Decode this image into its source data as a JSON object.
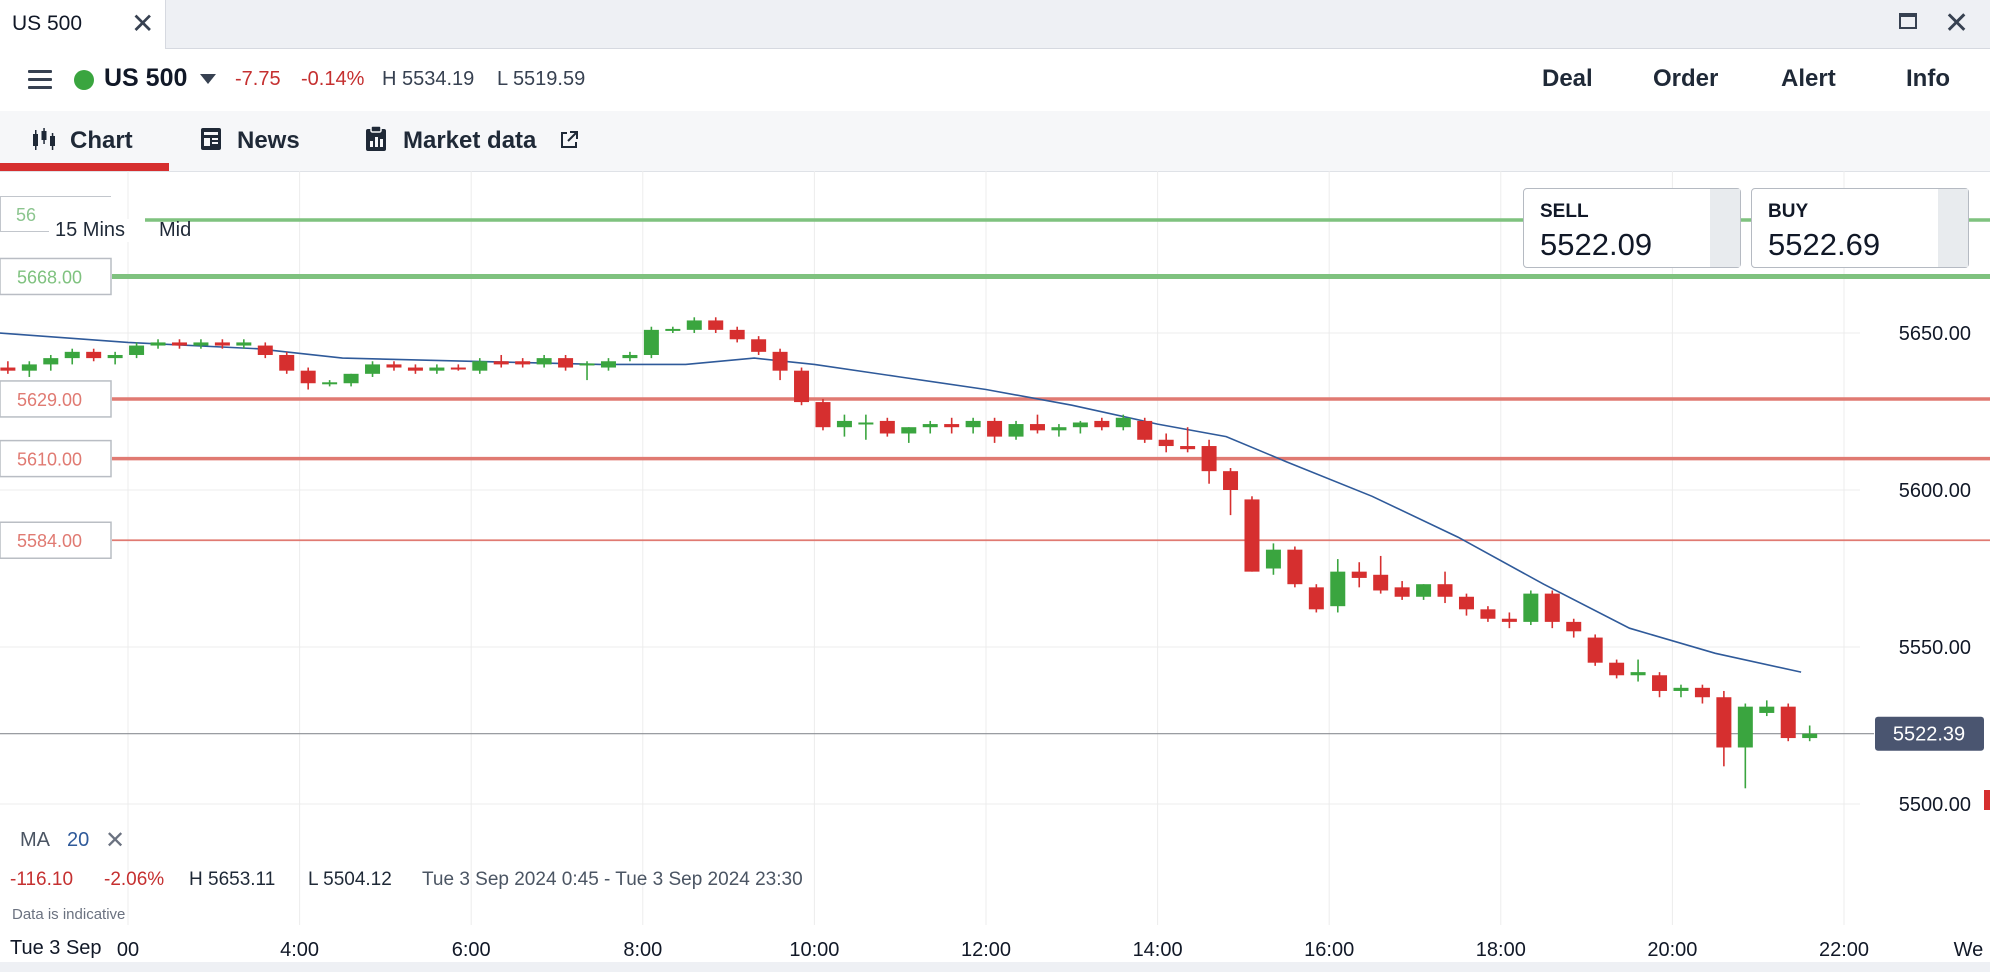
{
  "window": {
    "tab_title": "US 500",
    "tab_close": "✕",
    "close": "✕"
  },
  "header": {
    "market": "US 500",
    "change": "-7.75",
    "change_pct": "-0.14%",
    "high": "H 5534.19",
    "low": "L 5519.59",
    "actions": [
      "Deal",
      "Order",
      "Alert",
      "Info"
    ]
  },
  "subnav": {
    "chart": "Chart",
    "news": "News",
    "market_data": "Market data"
  },
  "trade": {
    "sell_label": "SELL",
    "sell_price": "5522.09",
    "buy_label": "BUY",
    "buy_price": "5522.69"
  },
  "chart_controls": {
    "timeframe": "15 Mins",
    "price_type": "Mid",
    "top_level_partial": "56"
  },
  "indicator": {
    "label": "MA",
    "period": "20",
    "remove": "✕"
  },
  "summary": {
    "change": "-116.10",
    "change_pct": "-2.06%",
    "high": "H 5653.11",
    "low": "L 5504.12",
    "range": "Tue 3 Sep 2024 0:45 - Tue 3 Sep 2024 23:30"
  },
  "disclaimer": "Data is indicative",
  "date_label": "Tue 3 Sep",
  "colors": {
    "up": "#3aa53f",
    "down": "#d62f2f",
    "ma": "#2f5a9a",
    "level_green": "#7fc27f",
    "level_red": "#e07a72",
    "current_badge": "#4a5570"
  },
  "chart_data": {
    "type": "candlestick",
    "interval": "15 Mins",
    "y_ticks": [
      "5650.00",
      "5600.00",
      "5550.00",
      "5500.00"
    ],
    "y_tick_values": [
      5650,
      5600,
      5550,
      5500
    ],
    "ylim": [
      5460,
      5700
    ],
    "x_ticks": [
      "00",
      "4:00",
      "6:00",
      "8:00",
      "10:00",
      "12:00",
      "14:00",
      "16:00",
      "18:00",
      "20:00",
      "22:00",
      "We"
    ],
    "x_tick_hours": [
      2,
      4,
      6,
      8,
      10,
      12,
      14,
      16,
      18,
      20,
      22,
      23.45
    ],
    "xlim_hours": [
      0.5,
      23.6
    ],
    "current_price": 5522.39,
    "current_price_label": "5522.39",
    "levels": [
      {
        "value": 5686,
        "label": "56",
        "color": "green",
        "weight": "medium"
      },
      {
        "value": 5668,
        "label": "5668.00",
        "color": "green",
        "weight": "heavy"
      },
      {
        "value": 5629,
        "label": "5629.00",
        "color": "red",
        "weight": "medium"
      },
      {
        "value": 5610,
        "label": "5610.00",
        "color": "red",
        "weight": "medium"
      },
      {
        "value": 5584,
        "label": "5584.00",
        "color": "red",
        "weight": "light"
      }
    ],
    "candles": [
      {
        "t": 0.6,
        "o": 5639,
        "h": 5641,
        "l": 5637,
        "c": 5638
      },
      {
        "t": 0.85,
        "o": 5638,
        "h": 5641,
        "l": 5636,
        "c": 5640
      },
      {
        "t": 1.1,
        "o": 5640,
        "h": 5643,
        "l": 5638,
        "c": 5642
      },
      {
        "t": 1.35,
        "o": 5642,
        "h": 5645,
        "l": 5640,
        "c": 5644
      },
      {
        "t": 1.6,
        "o": 5644,
        "h": 5645,
        "l": 5641,
        "c": 5642
      },
      {
        "t": 1.85,
        "o": 5642,
        "h": 5644,
        "l": 5640,
        "c": 5643
      },
      {
        "t": 2.1,
        "o": 5643,
        "h": 5647,
        "l": 5642,
        "c": 5646
      },
      {
        "t": 2.35,
        "o": 5646,
        "h": 5648,
        "l": 5645,
        "c": 5647
      },
      {
        "t": 2.6,
        "o": 5647,
        "h": 5648,
        "l": 5645,
        "c": 5646
      },
      {
        "t": 2.85,
        "o": 5646,
        "h": 5648,
        "l": 5645,
        "c": 5647
      },
      {
        "t": 3.1,
        "o": 5647,
        "h": 5648,
        "l": 5645,
        "c": 5646
      },
      {
        "t": 3.35,
        "o": 5646,
        "h": 5648,
        "l": 5645,
        "c": 5647
      },
      {
        "t": 3.6,
        "o": 5646,
        "h": 5647,
        "l": 5642,
        "c": 5643
      },
      {
        "t": 3.85,
        "o": 5643,
        "h": 5644,
        "l": 5637,
        "c": 5638
      },
      {
        "t": 4.1,
        "o": 5638,
        "h": 5639,
        "l": 5632,
        "c": 5634
      },
      {
        "t": 4.35,
        "o": 5634,
        "h": 5635,
        "l": 5633,
        "c": 5634.3
      },
      {
        "t": 4.6,
        "o": 5634,
        "h": 5637,
        "l": 5633,
        "c": 5637
      },
      {
        "t": 4.85,
        "o": 5637,
        "h": 5641,
        "l": 5636,
        "c": 5640
      },
      {
        "t": 5.1,
        "o": 5640,
        "h": 5641,
        "l": 5638,
        "c": 5639
      },
      {
        "t": 5.35,
        "o": 5639,
        "h": 5640,
        "l": 5637,
        "c": 5638
      },
      {
        "t": 5.6,
        "o": 5638,
        "h": 5640,
        "l": 5637,
        "c": 5639
      },
      {
        "t": 5.85,
        "o": 5639,
        "h": 5640,
        "l": 5638,
        "c": 5638.5
      },
      {
        "t": 6.1,
        "o": 5638,
        "h": 5642,
        "l": 5637,
        "c": 5641
      },
      {
        "t": 6.35,
        "o": 5641,
        "h": 5643,
        "l": 5639,
        "c": 5640
      },
      {
        "t": 6.6,
        "o": 5641,
        "h": 5642,
        "l": 5639,
        "c": 5640
      },
      {
        "t": 6.85,
        "o": 5640,
        "h": 5643,
        "l": 5639,
        "c": 5642
      },
      {
        "t": 7.1,
        "o": 5642,
        "h": 5643,
        "l": 5638,
        "c": 5639
      },
      {
        "t": 7.35,
        "o": 5640,
        "h": 5641,
        "l": 5635,
        "c": 5640.3
      },
      {
        "t": 7.6,
        "o": 5639,
        "h": 5642,
        "l": 5638,
        "c": 5641
      },
      {
        "t": 7.85,
        "o": 5642,
        "h": 5644,
        "l": 5641,
        "c": 5643
      },
      {
        "t": 8.1,
        "o": 5643,
        "h": 5652,
        "l": 5642,
        "c": 5651
      },
      {
        "t": 8.35,
        "o": 5651,
        "h": 5652,
        "l": 5650,
        "c": 5651.3
      },
      {
        "t": 8.6,
        "o": 5651,
        "h": 5655,
        "l": 5650,
        "c": 5654
      },
      {
        "t": 8.85,
        "o": 5654,
        "h": 5655,
        "l": 5650,
        "c": 5651
      },
      {
        "t": 9.1,
        "o": 5651,
        "h": 5652,
        "l": 5647,
        "c": 5648
      },
      {
        "t": 9.35,
        "o": 5648,
        "h": 5649,
        "l": 5643,
        "c": 5644
      },
      {
        "t": 9.6,
        "o": 5644,
        "h": 5645,
        "l": 5635,
        "c": 5638
      },
      {
        "t": 9.85,
        "o": 5638,
        "h": 5639,
        "l": 5627,
        "c": 5628
      },
      {
        "t": 10.1,
        "o": 5628,
        "h": 5629,
        "l": 5619,
        "c": 5620
      },
      {
        "t": 10.35,
        "o": 5620,
        "h": 5624,
        "l": 5617,
        "c": 5622
      },
      {
        "t": 10.6,
        "o": 5621,
        "h": 5624,
        "l": 5616,
        "c": 5621.5
      },
      {
        "t": 10.85,
        "o": 5622,
        "h": 5623,
        "l": 5617,
        "c": 5618
      },
      {
        "t": 11.1,
        "o": 5618,
        "h": 5620,
        "l": 5615,
        "c": 5620
      },
      {
        "t": 11.35,
        "o": 5620,
        "h": 5622,
        "l": 5618,
        "c": 5621
      },
      {
        "t": 11.6,
        "o": 5621,
        "h": 5623,
        "l": 5618,
        "c": 5620
      },
      {
        "t": 11.85,
        "o": 5620,
        "h": 5623,
        "l": 5618,
        "c": 5622
      },
      {
        "t": 12.1,
        "o": 5622,
        "h": 5623,
        "l": 5615,
        "c": 5617
      },
      {
        "t": 12.35,
        "o": 5617,
        "h": 5622,
        "l": 5616,
        "c": 5621
      },
      {
        "t": 12.6,
        "o": 5621,
        "h": 5624,
        "l": 5618,
        "c": 5619
      },
      {
        "t": 12.85,
        "o": 5619,
        "h": 5621,
        "l": 5617,
        "c": 5620
      },
      {
        "t": 13.1,
        "o": 5620,
        "h": 5622,
        "l": 5618,
        "c": 5621.5
      },
      {
        "t": 13.35,
        "o": 5622,
        "h": 5623,
        "l": 5619,
        "c": 5620
      },
      {
        "t": 13.6,
        "o": 5620,
        "h": 5624,
        "l": 5619,
        "c": 5623
      },
      {
        "t": 13.85,
        "o": 5622,
        "h": 5623,
        "l": 5615,
        "c": 5616
      },
      {
        "t": 14.1,
        "o": 5616,
        "h": 5618,
        "l": 5612,
        "c": 5614
      },
      {
        "t": 14.35,
        "o": 5614,
        "h": 5620,
        "l": 5612,
        "c": 5613
      },
      {
        "t": 14.6,
        "o": 5614,
        "h": 5616,
        "l": 5602,
        "c": 5606
      },
      {
        "t": 14.85,
        "o": 5606,
        "h": 5607,
        "l": 5592,
        "c": 5600
      },
      {
        "t": 15.1,
        "o": 5597,
        "h": 5598,
        "l": 5574,
        "c": 5574
      },
      {
        "t": 15.35,
        "o": 5575,
        "h": 5583,
        "l": 5573,
        "c": 5581
      },
      {
        "t": 15.6,
        "o": 5581,
        "h": 5582,
        "l": 5569,
        "c": 5570
      },
      {
        "t": 15.85,
        "o": 5569,
        "h": 5570,
        "l": 5561,
        "c": 5562
      },
      {
        "t": 16.1,
        "o": 5563,
        "h": 5578,
        "l": 5561,
        "c": 5574
      },
      {
        "t": 16.35,
        "o": 5574,
        "h": 5577,
        "l": 5569,
        "c": 5572
      },
      {
        "t": 16.6,
        "o": 5573,
        "h": 5579,
        "l": 5567,
        "c": 5568
      },
      {
        "t": 16.85,
        "o": 5569,
        "h": 5571,
        "l": 5565,
        "c": 5566
      },
      {
        "t": 17.1,
        "o": 5566,
        "h": 5570,
        "l": 5565,
        "c": 5570
      },
      {
        "t": 17.35,
        "o": 5570,
        "h": 5574,
        "l": 5564,
        "c": 5566
      },
      {
        "t": 17.6,
        "o": 5566,
        "h": 5567,
        "l": 5560,
        "c": 5562
      },
      {
        "t": 17.85,
        "o": 5562,
        "h": 5563,
        "l": 5558,
        "c": 5559
      },
      {
        "t": 18.1,
        "o": 5559,
        "h": 5561,
        "l": 5556,
        "c": 5558
      },
      {
        "t": 18.35,
        "o": 5558,
        "h": 5568,
        "l": 5557,
        "c": 5567
      },
      {
        "t": 18.6,
        "o": 5567,
        "h": 5568,
        "l": 5556,
        "c": 5558
      },
      {
        "t": 18.85,
        "o": 5558,
        "h": 5559,
        "l": 5553,
        "c": 5555
      },
      {
        "t": 19.1,
        "o": 5553,
        "h": 5554,
        "l": 5544,
        "c": 5545
      },
      {
        "t": 19.35,
        "o": 5545,
        "h": 5546,
        "l": 5540,
        "c": 5541
      },
      {
        "t": 19.6,
        "o": 5541,
        "h": 5546,
        "l": 5539,
        "c": 5542
      },
      {
        "t": 19.85,
        "o": 5541,
        "h": 5542,
        "l": 5534,
        "c": 5536
      },
      {
        "t": 20.1,
        "o": 5536,
        "h": 5538,
        "l": 5534,
        "c": 5537
      },
      {
        "t": 20.35,
        "o": 5537,
        "h": 5538,
        "l": 5532,
        "c": 5534
      },
      {
        "t": 20.6,
        "o": 5534,
        "h": 5536,
        "l": 5512,
        "c": 5518
      },
      {
        "t": 20.85,
        "o": 5518,
        "h": 5532,
        "l": 5505,
        "c": 5531
      },
      {
        "t": 21.1,
        "o": 5529,
        "h": 5533,
        "l": 5528,
        "c": 5531
      },
      {
        "t": 21.35,
        "o": 5531,
        "h": 5532,
        "l": 5520,
        "c": 5521
      },
      {
        "t": 21.6,
        "o": 5521,
        "h": 5525,
        "l": 5520,
        "c": 5522.4
      }
    ],
    "ma": {
      "label": "MA 20",
      "points": [
        [
          0.5,
          5650
        ],
        [
          2.0,
          5647
        ],
        [
          3.5,
          5645
        ],
        [
          4.5,
          5642
        ],
        [
          6.0,
          5641
        ],
        [
          7.5,
          5640
        ],
        [
          8.5,
          5640
        ],
        [
          9.3,
          5642
        ],
        [
          10.0,
          5640
        ],
        [
          11.0,
          5636
        ],
        [
          12.0,
          5632
        ],
        [
          13.0,
          5627
        ],
        [
          14.0,
          5621
        ],
        [
          14.8,
          5617
        ],
        [
          15.5,
          5609
        ],
        [
          16.5,
          5598
        ],
        [
          17.5,
          5585
        ],
        [
          18.5,
          5570
        ],
        [
          19.5,
          5556
        ],
        [
          20.5,
          5548
        ],
        [
          21.5,
          5542
        ]
      ]
    }
  }
}
